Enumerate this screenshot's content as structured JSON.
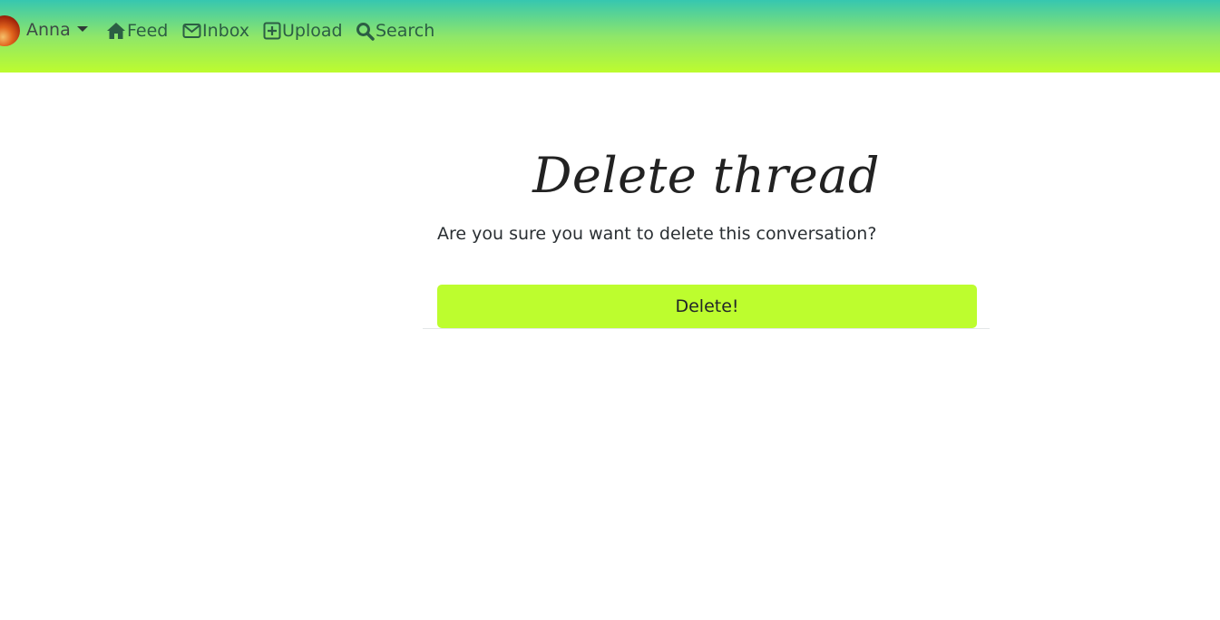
{
  "navbar": {
    "user": {
      "name": "Anna"
    },
    "links": {
      "feed": "Feed",
      "inbox": "Inbox",
      "upload": "Upload",
      "search": "Search"
    },
    "icons": {
      "feed": "home-icon",
      "inbox": "envelope-icon",
      "upload": "plus-square-icon",
      "search": "search-icon"
    },
    "gradient": [
      "#36c7b0",
      "#8ee66a",
      "#bdfc2e"
    ]
  },
  "main": {
    "title": "Delete thread",
    "question": "Are you sure you want to delete this conversation?",
    "delete_label": "Delete!",
    "button_color": "#bdfd2e"
  }
}
